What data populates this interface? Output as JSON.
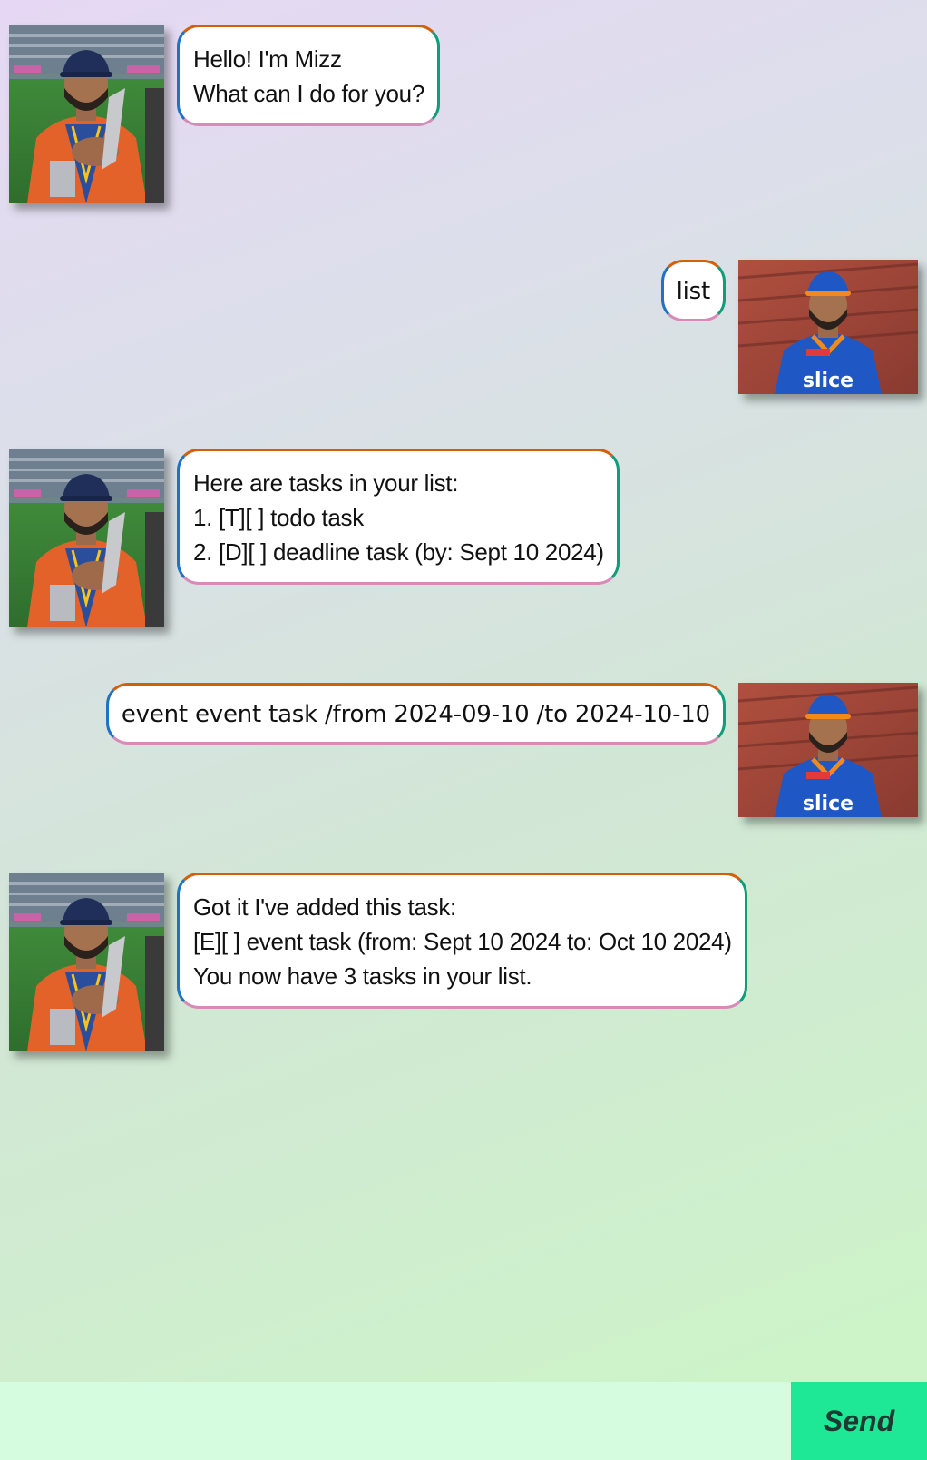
{
  "window": {
    "title": "Mizz"
  },
  "colors": {
    "bubble_border_top": "#d35f0c",
    "bubble_border_right": "#139c7a",
    "bubble_border_bottom": "#d88bb8",
    "bubble_border_left": "#1f72c4",
    "send_button": "#1ee896",
    "input_bar": "#d6fce0"
  },
  "conversation": [
    {
      "sender": "bot",
      "avatar": "bot-avatar-photo",
      "lines": [
        "Hello! I'm Mizz",
        "What can I do for you?"
      ]
    },
    {
      "sender": "user",
      "avatar": "user-avatar-photo",
      "lines": [
        "list"
      ]
    },
    {
      "sender": "bot",
      "avatar": "bot-avatar-photo",
      "lines": [
        "Here are tasks in your list:",
        "1. [T][ ] todo task",
        "2. [D][ ] deadline task (by: Sept 10 2024)"
      ]
    },
    {
      "sender": "user",
      "avatar": "user-avatar-photo",
      "lines": [
        "event event task /from 2024-09-10 /to 2024-10-10"
      ]
    },
    {
      "sender": "bot",
      "avatar": "bot-avatar-photo",
      "lines": [
        "Got it I've added this task:",
        "[E][ ] event task (from: Sept 10 2024 to: Oct 10 2024)",
        "You now have 3 tasks in your list."
      ]
    }
  ],
  "input": {
    "value": "",
    "placeholder": ""
  },
  "send_button": {
    "label": "Send"
  }
}
